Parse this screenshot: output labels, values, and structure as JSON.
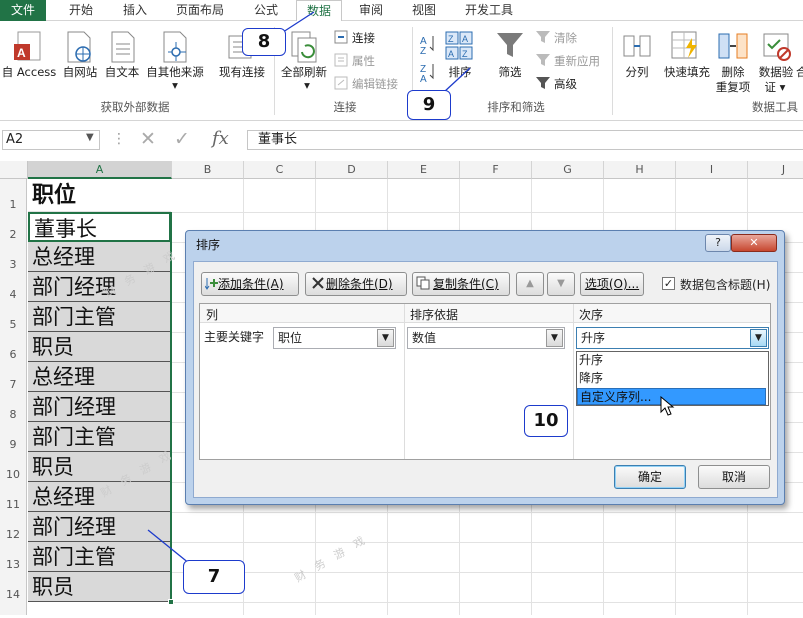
{
  "tabs": [
    "文件",
    "开始",
    "插入",
    "页面布局",
    "公式",
    "数据",
    "审阅",
    "视图",
    "开发工具"
  ],
  "ribbon": {
    "external": {
      "access": "自 Access",
      "web": "自网站",
      "text": "自文本",
      "other": "自其他来源",
      "existing": "现有连接",
      "group": "获取外部数据"
    },
    "connections": {
      "refresh": "全部刷新",
      "connections": "连接",
      "properties": "属性",
      "edit_links": "编辑链接",
      "group": "连接"
    },
    "sortfilter": {
      "sort": "排序",
      "filter": "筛选",
      "clear": "清除",
      "reapply": "重新应用",
      "advanced": "高级",
      "group": "排序和筛选"
    },
    "tools": {
      "split": "分列",
      "flash": "快速填充",
      "dedupe1": "删除",
      "dedupe2": "重复项",
      "validate1": "数据验",
      "validate2": "证 ▾",
      "partial": "合",
      "group": "数据工具"
    }
  },
  "formula_bar": {
    "name_box": "A2",
    "fx": "fx",
    "value": "董事长"
  },
  "columns": [
    "A",
    "B",
    "C",
    "D",
    "E",
    "F",
    "G",
    "H",
    "I",
    "J"
  ],
  "rows": [
    "1",
    "2",
    "3",
    "4",
    "5",
    "6",
    "7",
    "8",
    "9",
    "10",
    "11",
    "12",
    "13",
    "14"
  ],
  "cells": [
    "职位",
    "董事长",
    "总经理",
    "部门经理",
    "部门主管",
    "职员",
    "总经理",
    "部门经理",
    "部门主管",
    "职员",
    "总经理",
    "部门经理",
    "部门主管",
    "职员"
  ],
  "callouts": {
    "c7": "7",
    "c8": "8",
    "c9": "9",
    "c10": "10"
  },
  "watermark": "财 务 游 戏",
  "dialog": {
    "title": "排序",
    "help": "?",
    "close": "✕",
    "add_level": "添加条件(A)",
    "delete_level": "删除条件(D)",
    "copy_level": "复制条件(C)",
    "up": "▲",
    "down": "▼",
    "options": "选项(O)...",
    "header_check": "数据包含标题(H)",
    "col_header": "列",
    "sort_on_header": "排序依据",
    "order_header": "次序",
    "primary_key": "主要关键字",
    "column_value": "职位",
    "sort_on_value": "数值",
    "order_value": "升序",
    "order_options": [
      "升序",
      "降序",
      "自定义序列..."
    ],
    "ok": "确定",
    "cancel": "取消"
  },
  "colors": {
    "excel_green": "#217346",
    "callout_border": "#1d3bcc",
    "highlight": "#3399ff"
  }
}
